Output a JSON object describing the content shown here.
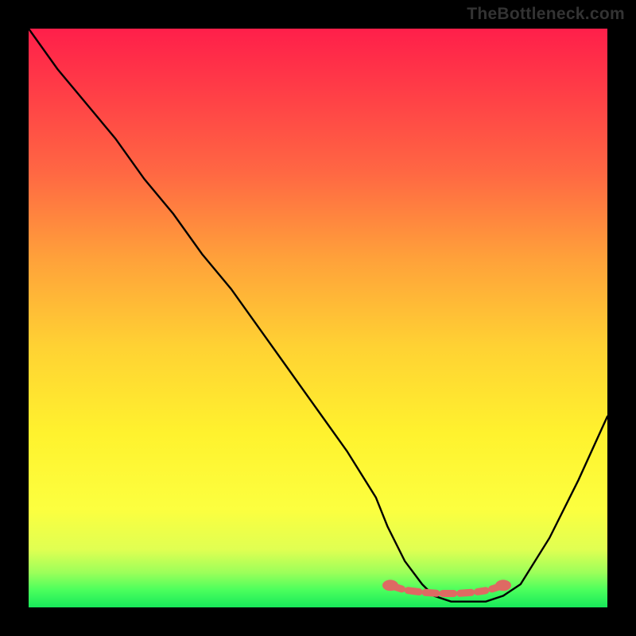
{
  "attribution": "TheBottleneck.com",
  "chart_data": {
    "type": "line",
    "title": "",
    "xlabel": "",
    "ylabel": "",
    "xlim": [
      0,
      100
    ],
    "ylim": [
      0,
      100
    ],
    "series": [
      {
        "name": "bottleneck-curve",
        "x": [
          0,
          5,
          10,
          15,
          20,
          25,
          30,
          35,
          40,
          45,
          50,
          55,
          60,
          62,
          65,
          68,
          70,
          73,
          76,
          79,
          82,
          85,
          90,
          95,
          100
        ],
        "values": [
          100,
          93,
          87,
          81,
          74,
          68,
          61,
          55,
          48,
          41,
          34,
          27,
          19,
          14,
          8,
          4,
          2,
          1,
          1,
          1,
          2,
          4,
          12,
          22,
          33
        ]
      }
    ],
    "markers": {
      "name": "recommended-range",
      "shape": "rounded-dash",
      "color": "#de6a63",
      "x": [
        62.5,
        65,
        68,
        71,
        74,
        77,
        79.5,
        82
      ],
      "y": [
        3.8,
        3.0,
        2.6,
        2.4,
        2.4,
        2.6,
        3.0,
        3.8
      ]
    },
    "gradient_meaning": "red = high bottleneck, green = optimal match"
  }
}
